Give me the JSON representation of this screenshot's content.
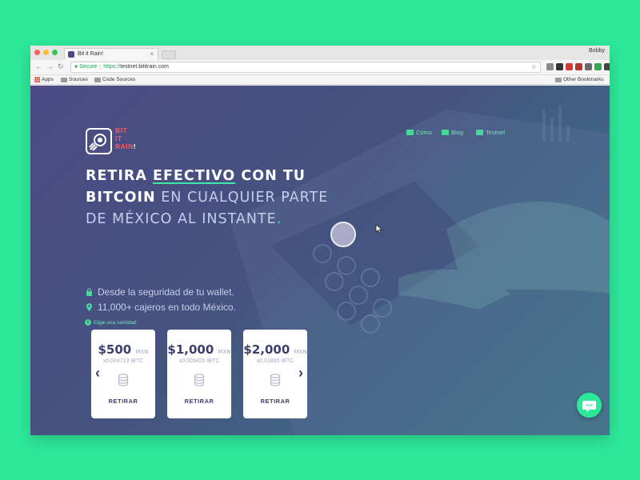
{
  "browser": {
    "tab_title": "Bit it Rain!",
    "tab_close": "×",
    "profile_name": "Bobby",
    "url_secure_label": "Secure",
    "url_scheme": "https://",
    "url_host": "testnet.bititrain.com",
    "bookmarks": {
      "apps": "Apps",
      "sources": "Sources",
      "code_sources": "Code Sources",
      "other": "Other Bookmarks"
    },
    "extension_icons": [
      {
        "name": "bulb-extension-icon",
        "color": "#8a8a8a"
      },
      {
        "name": "layers-extension-icon",
        "color": "#333333"
      },
      {
        "name": "abp-extension-icon",
        "color": "#d83a2f"
      },
      {
        "name": "pdf-extension-icon",
        "color": "#b0392e"
      },
      {
        "name": "grid-extension-icon",
        "color": "#6a6a6a"
      },
      {
        "name": "green-circle-extension-icon",
        "color": "#34a853"
      },
      {
        "name": "font-extension-icon",
        "color": "#444444"
      },
      {
        "name": "pen-extension-icon",
        "color": "#777777"
      },
      {
        "name": "menu-extension-icon",
        "color": "#888888"
      },
      {
        "name": "red-extension-icon",
        "color": "#d9342b"
      }
    ]
  },
  "site": {
    "logo_lines": [
      "BIT",
      "IT",
      "RAIN"
    ],
    "logo_bang": "!",
    "nav": [
      {
        "label": "Cómo",
        "icon": "wallet-icon"
      },
      {
        "label": "Blog",
        "icon": "blog-icon"
      },
      {
        "label": "Testnet",
        "icon": "testnet-icon"
      }
    ],
    "hero": {
      "retira": "RETIRA ",
      "efectivo": "EFECTIVO",
      "con_tu": " CON TU",
      "bitcoin": "BITCOIN",
      "rest_line2": " EN CUALQUIER PARTE",
      "line3": "DE MÉXICO AL INSTANTE",
      "dot": "."
    },
    "features": [
      {
        "icon": "lock-icon",
        "text": "Desde la seguridad de tu wallet."
      },
      {
        "icon": "location-pin-icon",
        "text": "11,000+ cajeros en todo México."
      }
    ],
    "amount_hint": "Elige una cantidad",
    "amount_hint_icon": "i",
    "cards": [
      {
        "price": "$500",
        "currency": "MXN",
        "btc": "x0.004713 tBTC",
        "action": "RETIRAR"
      },
      {
        "price": "$1,000",
        "currency": "MXN",
        "btc": "x0.009425 tBTC",
        "action": "RETIRAR"
      },
      {
        "price": "$2,000",
        "currency": "MXN",
        "btc": "x0.01885 tBTC",
        "action": "RETIRAR"
      }
    ],
    "arrows": {
      "left": "‹",
      "right": "›"
    },
    "colors": {
      "accent": "#2ee89a",
      "hero_bg": "#4b4a84",
      "logo_red": "#ff5a5f",
      "card_text": "#3e3f6e"
    }
  }
}
